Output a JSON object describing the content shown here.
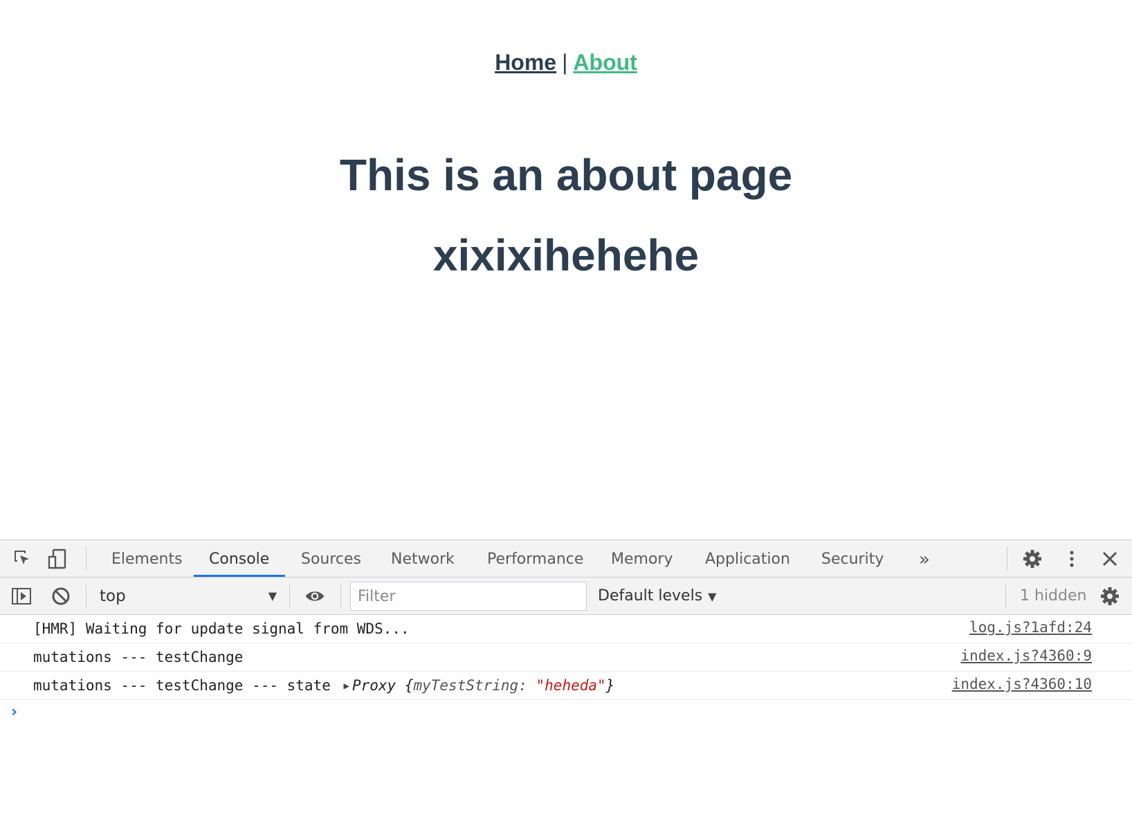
{
  "page": {
    "nav": {
      "home": "Home",
      "separator": "|",
      "about": "About"
    },
    "heading": "This is an about page",
    "subheading": "xixixihehehe"
  },
  "devtools": {
    "tabs": [
      "Elements",
      "Console",
      "Sources",
      "Network",
      "Performance",
      "Memory",
      "Application",
      "Security"
    ],
    "active_tab": "Console",
    "more_tabs_glyph": "»",
    "console_toolbar": {
      "context": "top",
      "filter_placeholder": "Filter",
      "levels": "Default levels",
      "hidden_count": "1 hidden"
    },
    "messages": [
      {
        "text": "[HMR] Waiting for update signal from WDS...",
        "source": "log.js?1afd:24"
      },
      {
        "text": "mutations --- testChange",
        "source": "index.js?4360:9"
      },
      {
        "text": "mutations --- testChange --- state",
        "object_label": "Proxy",
        "object_key": "myTestString:",
        "object_value": "\"heheda\"",
        "source": "index.js?4360:10"
      }
    ],
    "prompt_glyph": "›"
  },
  "colors": {
    "heading": "#2c3e50",
    "link_active": "#42b983",
    "accent": "#1a73e8",
    "string": "#c41a16"
  }
}
